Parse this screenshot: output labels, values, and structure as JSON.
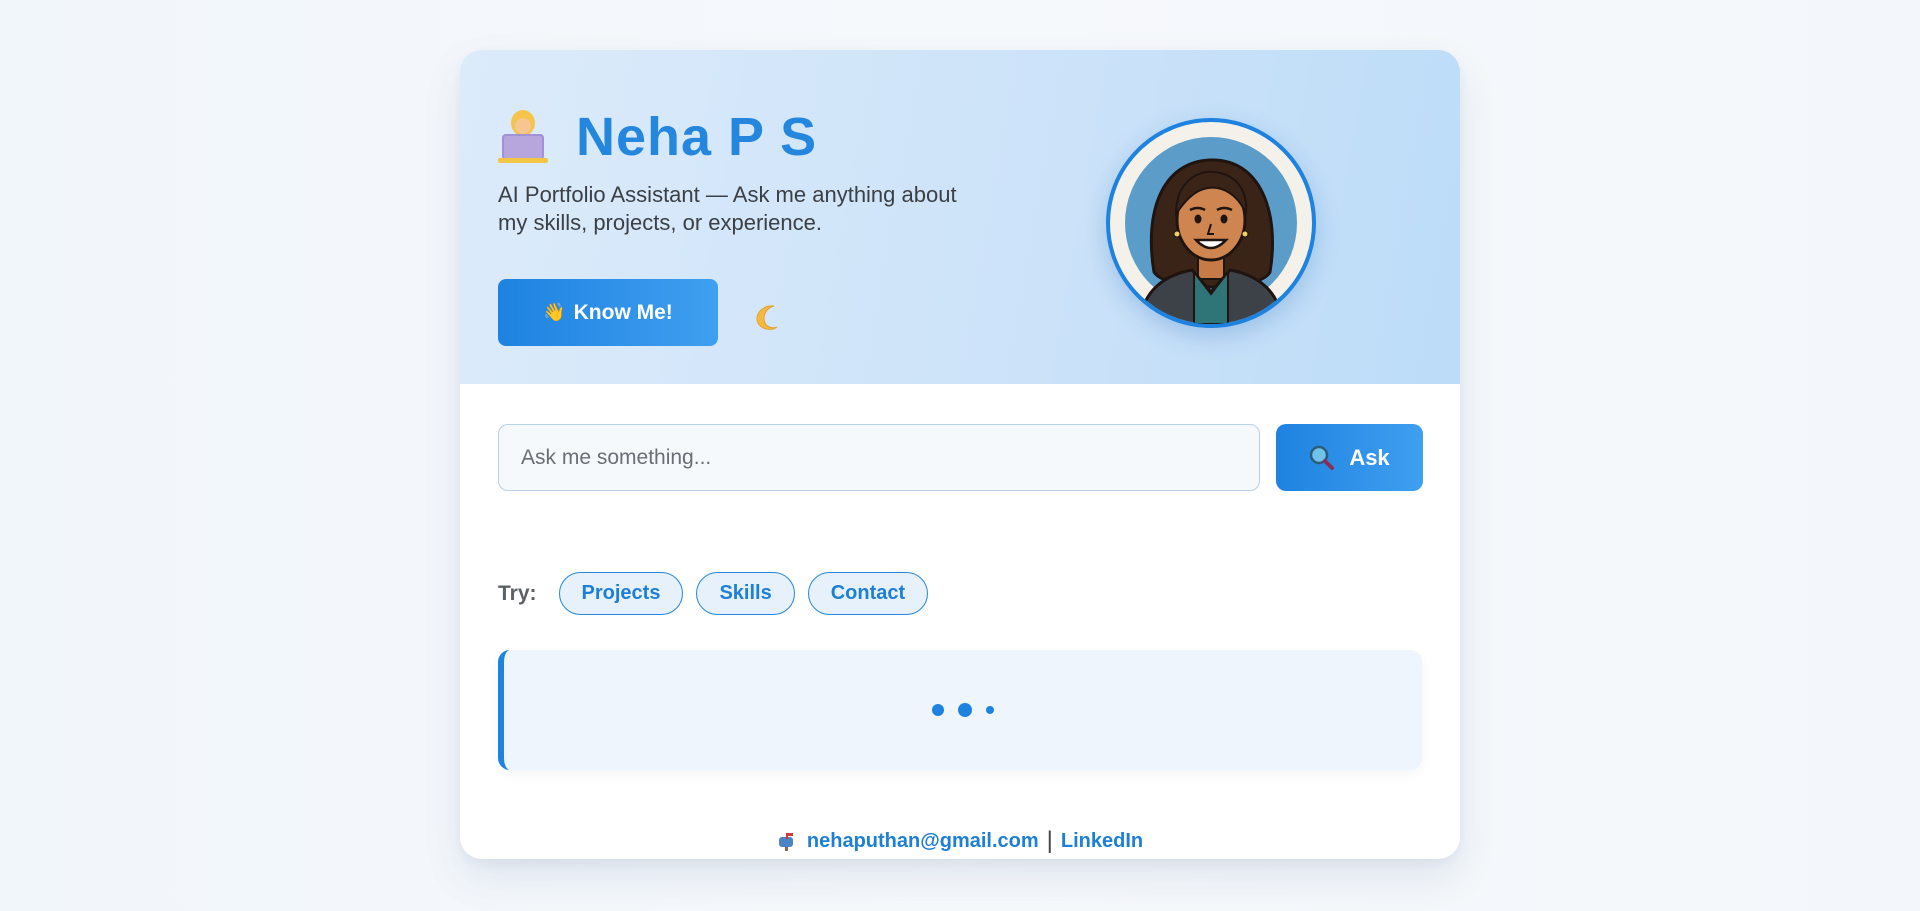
{
  "hero": {
    "title": "Neha P S",
    "title_icon": "woman-technologist-icon",
    "subtitle": "AI Portfolio Assistant — Ask me anything about my skills, projects, or experience.",
    "know_button": {
      "icon": "waving-hand-icon",
      "icon_glyph": "👋",
      "label": "Know Me!"
    },
    "theme_toggle_icon": "crescent-moon-icon",
    "avatar_icon": "profile-avatar"
  },
  "ask": {
    "placeholder": "Ask me something...",
    "value": "",
    "button_label": "Ask",
    "button_icon": "magnifier-icon"
  },
  "suggestions": {
    "label": "Try:",
    "chips": [
      "Projects",
      "Skills",
      "Contact"
    ]
  },
  "answer": {
    "state": "loading"
  },
  "footer": {
    "icon": "mailbox-icon",
    "email": "nehaputhan@gmail.com",
    "separator": "|",
    "link_label": "LinkedIn"
  },
  "colors": {
    "accent": "#1e82e0",
    "title": "#2487dd",
    "hero_bg": "#cde3f9",
    "chip_bg": "#e6f1fb",
    "answer_bg": "#eef5fc"
  }
}
